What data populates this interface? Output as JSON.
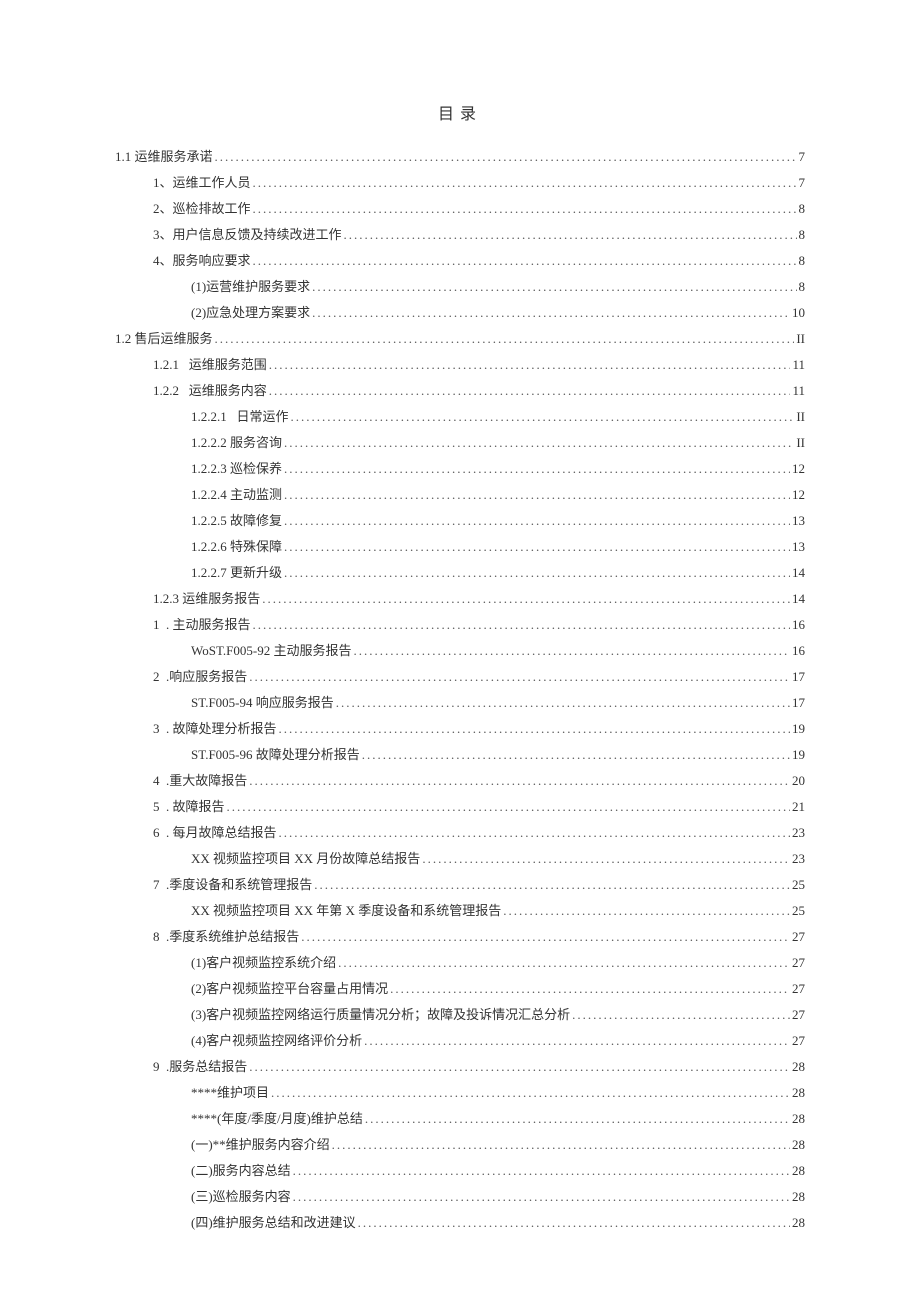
{
  "title": "目录",
  "entries": [
    {
      "indent": 0,
      "label": "1.1 运维服务承诺",
      "page": "7"
    },
    {
      "indent": 1,
      "label": "1、运维工作人员",
      "page": "7"
    },
    {
      "indent": 1,
      "label": "2、巡检排故工作",
      "page": "8"
    },
    {
      "indent": 1,
      "label": "3、用户信息反馈及持续改进工作",
      "page": "8"
    },
    {
      "indent": 1,
      "label": "4、服务响应要求",
      "page": "8"
    },
    {
      "indent": 2,
      "label": "(1)运营维护服务要求",
      "page": "8"
    },
    {
      "indent": 2,
      "label": "(2)应急处理方案要求",
      "page": "10"
    },
    {
      "indent": 0,
      "label": "1.2 售后运维服务",
      "page": "II"
    },
    {
      "indent": 1,
      "label": "1.2.1   运维服务范围",
      "page": "11"
    },
    {
      "indent": 1,
      "label": "1.2.2   运维服务内容",
      "page": "11"
    },
    {
      "indent": 2,
      "label": "1.2.2.1   日常运作",
      "page": "II"
    },
    {
      "indent": 2,
      "label": "1.2.2.2 服务咨询",
      "page": "II"
    },
    {
      "indent": 2,
      "label": "1.2.2.3 巡检保养",
      "page": "12"
    },
    {
      "indent": 2,
      "label": "1.2.2.4 主动监测",
      "page": "12"
    },
    {
      "indent": 2,
      "label": "1.2.2.5 故障修复",
      "page": "13"
    },
    {
      "indent": 2,
      "label": "1.2.2.6 特殊保障",
      "page": "13"
    },
    {
      "indent": 2,
      "label": "1.2.2.7 更新升级",
      "page": "14"
    },
    {
      "indent": 1,
      "label": "1.2.3 运维服务报告",
      "page": "14"
    },
    {
      "indent": 1,
      "label": "1  . 主动服务报告",
      "page": "16"
    },
    {
      "indent": 2,
      "label": "WoST.F005-92 主动服务报告",
      "page": "16"
    },
    {
      "indent": 1,
      "label": "2  .响应服务报告",
      "page": "17"
    },
    {
      "indent": 2,
      "label": "ST.F005-94 响应服务报告",
      "page": "17"
    },
    {
      "indent": 1,
      "label": "3  . 故障处理分析报告",
      "page": "19"
    },
    {
      "indent": 2,
      "label": "ST.F005-96 故障处理分析报告",
      "page": "19"
    },
    {
      "indent": 1,
      "label": "4  .重大故障报告",
      "page": "20"
    },
    {
      "indent": 1,
      "label": "5  . 故障报告",
      "page": "21"
    },
    {
      "indent": 1,
      "label": "6  . 每月故障总结报告",
      "page": "23"
    },
    {
      "indent": 2,
      "label": "XX 视频监控项目 XX 月份故障总结报告",
      "page": "23"
    },
    {
      "indent": 1,
      "label": "7  .季度设备和系统管理报告",
      "page": "25"
    },
    {
      "indent": 2,
      "label": "XX 视频监控项目 XX 年第 X 季度设备和系统管理报告",
      "page": "25"
    },
    {
      "indent": 1,
      "label": "8  .季度系统维护总结报告",
      "page": "27"
    },
    {
      "indent": 2,
      "label": "(1)客户视频监控系统介绍",
      "page": "27"
    },
    {
      "indent": 2,
      "label": "(2)客户视频监控平台容量占用情况",
      "page": "27"
    },
    {
      "indent": 2,
      "label": "(3)客户视频监控网络运行质量情况分析；故障及投诉情况汇总分析",
      "page": "27"
    },
    {
      "indent": 2,
      "label": "(4)客户视频监控网络评价分析",
      "page": "27"
    },
    {
      "indent": 1,
      "label": "9  .服务总结报告",
      "page": "28"
    },
    {
      "indent": 2,
      "label": "****维护项目",
      "page": "28"
    },
    {
      "indent": 2,
      "label": "****(年度/季度/月度)维护总结",
      "page": "28"
    },
    {
      "indent": 2,
      "label": "(一)**维护服务内容介绍",
      "page": "28"
    },
    {
      "indent": 2,
      "label": "(二)服务内容总结",
      "page": "28"
    },
    {
      "indent": 2,
      "label": "(三)巡检服务内容",
      "page": "28"
    },
    {
      "indent": 2,
      "label": "(四)维护服务总结和改进建议",
      "page": "28"
    }
  ]
}
